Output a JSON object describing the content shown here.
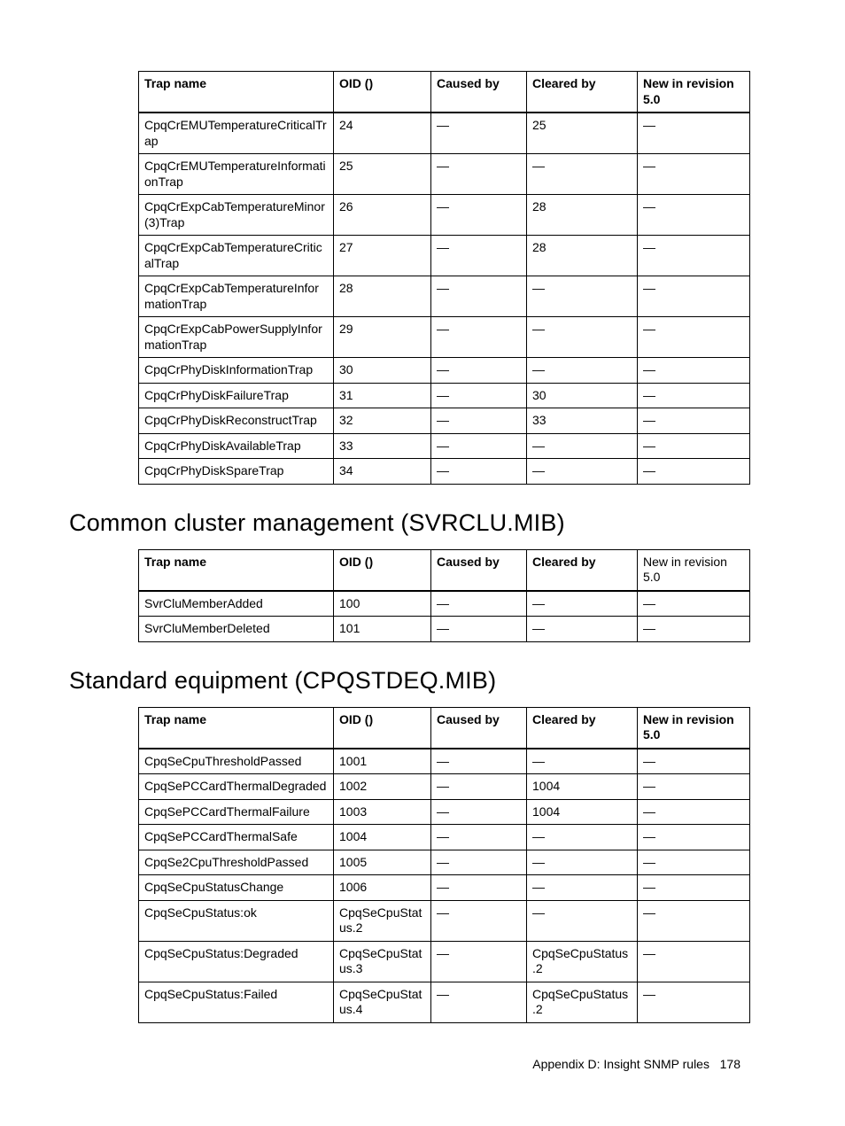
{
  "tables": [
    {
      "headers": [
        "Trap name",
        "OID ()",
        "Caused by",
        "Cleared by",
        "New in revision 5.0"
      ],
      "headerPlain": [
        false,
        false,
        false,
        false,
        false
      ],
      "rows": [
        [
          "CpqCrEMUTemperatureCriticalTrap",
          "24",
          "—",
          "25",
          "—"
        ],
        [
          "CpqCrEMUTemperatureInformationTrap",
          "25",
          "—",
          "—",
          "—"
        ],
        [
          "CpqCrExpCabTemperatureMinor(3)Trap",
          "26",
          "—",
          "28",
          "—"
        ],
        [
          "CpqCrExpCabTemperatureCriticalTrap",
          "27",
          "—",
          "28",
          "—"
        ],
        [
          "CpqCrExpCabTemperatureInformationTrap",
          "28",
          "—",
          "—",
          "—"
        ],
        [
          "CpqCrExpCabPowerSupplyInformationTrap",
          "29",
          "—",
          "—",
          "—"
        ],
        [
          "CpqCrPhyDiskInformationTrap",
          "30",
          "—",
          "—",
          "—"
        ],
        [
          "CpqCrPhyDiskFailureTrap",
          "31",
          "—",
          "30",
          "—"
        ],
        [
          "CpqCrPhyDiskReconstructTrap",
          "32",
          "—",
          "33",
          "—"
        ],
        [
          "CpqCrPhyDiskAvailableTrap",
          "33",
          "—",
          "—",
          "—"
        ],
        [
          "CpqCrPhyDiskSpareTrap",
          "34",
          "—",
          "—",
          "—"
        ]
      ]
    },
    {
      "heading": "Common cluster management (SVRCLU.MIB)",
      "headers": [
        "Trap name",
        "OID ()",
        "Caused by",
        "Cleared by",
        "New in revision 5.0"
      ],
      "headerPlain": [
        false,
        false,
        false,
        false,
        true
      ],
      "rows": [
        [
          "SvrCluMemberAdded",
          "100",
          "—",
          "—",
          "—"
        ],
        [
          "SvrCluMemberDeleted",
          "101",
          "—",
          "—",
          "—"
        ]
      ]
    },
    {
      "heading": "Standard equipment (CPQSTDEQ.MIB)",
      "headers": [
        "Trap name",
        "OID ()",
        "Caused by",
        "Cleared by",
        "New in revision 5.0"
      ],
      "headerPlain": [
        false,
        false,
        false,
        false,
        false
      ],
      "rows": [
        [
          "CpqSeCpuThresholdPassed",
          "1001",
          "—",
          "—",
          "—"
        ],
        [
          "CpqSePCCardThermalDegraded",
          "1002",
          "—",
          "1004",
          "—"
        ],
        [
          "CpqSePCCardThermalFailure",
          "1003",
          "—",
          "1004",
          "—"
        ],
        [
          "CpqSePCCardThermalSafe",
          "1004",
          "—",
          "—",
          "—"
        ],
        [
          "CpqSe2CpuThresholdPassed",
          "1005",
          "—",
          "—",
          "—"
        ],
        [
          "CpqSeCpuStatusChange",
          "1006",
          "—",
          "—",
          "—"
        ],
        [
          "CpqSeCpuStatus:ok",
          "CpqSeCpuStatus.2",
          "—",
          "—",
          "—"
        ],
        [
          "CpqSeCpuStatus:Degraded",
          "CpqSeCpuStatus.3",
          "—",
          "CpqSeCpuStatus.2",
          "—"
        ],
        [
          "CpqSeCpuStatus:Failed",
          "CpqSeCpuStatus.4",
          "—",
          "CpqSeCpuStatus.2",
          "—"
        ]
      ]
    }
  ],
  "footer": {
    "text": "Appendix D: Insight SNMP rules",
    "page": "178"
  }
}
